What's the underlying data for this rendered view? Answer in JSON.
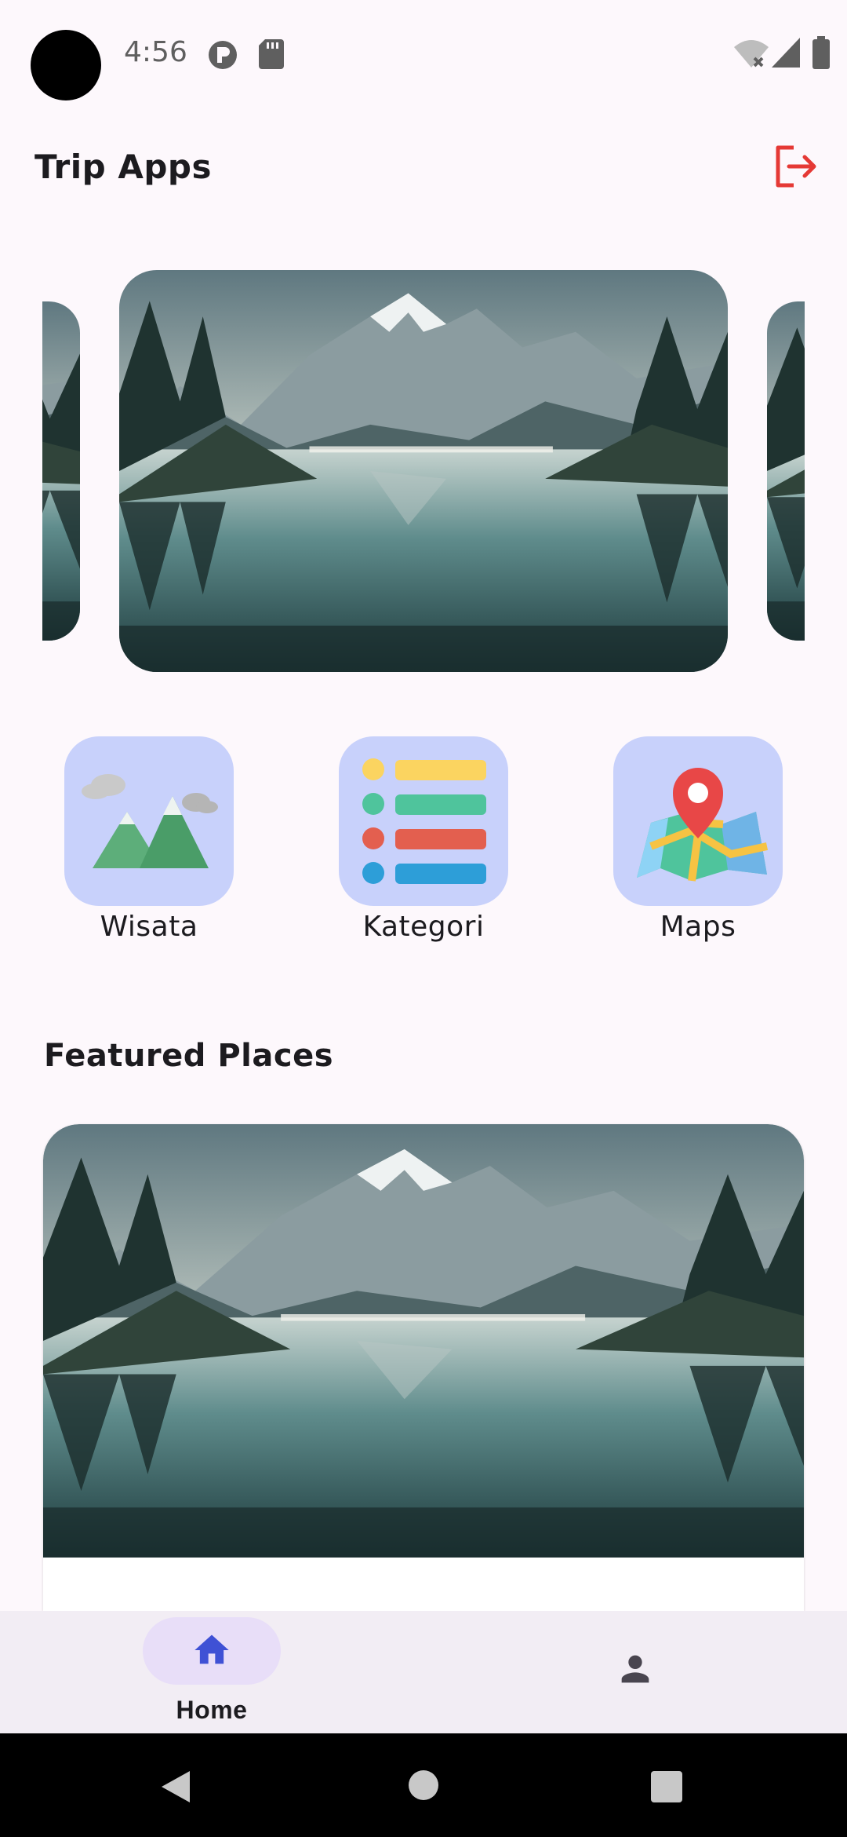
{
  "status_bar": {
    "time": "4:56",
    "icons": [
      "camera-cutout",
      "notification-p-icon",
      "sd-card-icon",
      "wifi-off-icon",
      "signal-icon",
      "battery-icon"
    ]
  },
  "app_bar": {
    "title": "Trip Apps",
    "logout_icon": "logout-icon",
    "accent_color": "#e53935"
  },
  "carousel": {
    "slides": [
      {
        "image": "mountain-lake-landscape"
      },
      {
        "image": "mountain-lake-landscape"
      },
      {
        "image": "mountain-lake-landscape"
      }
    ]
  },
  "menu": {
    "tile_color": "#c8d1fb",
    "items": [
      {
        "label": "Wisata",
        "icon": "mountains-icon"
      },
      {
        "label": "Kategori",
        "icon": "list-icon"
      },
      {
        "label": "Maps",
        "icon": "map-pin-icon"
      }
    ]
  },
  "featured": {
    "title": "Featured Places",
    "cards": [
      {
        "image": "mountain-lake-landscape"
      }
    ]
  },
  "bottom_nav": {
    "items": [
      {
        "label": "Home",
        "icon": "home-icon",
        "selected": true
      },
      {
        "label": "",
        "icon": "person-icon",
        "selected": false
      }
    ],
    "active_color": "#3f51d5"
  },
  "system_nav": {
    "buttons": [
      "back-icon",
      "home-circle-icon",
      "recents-icon"
    ]
  }
}
